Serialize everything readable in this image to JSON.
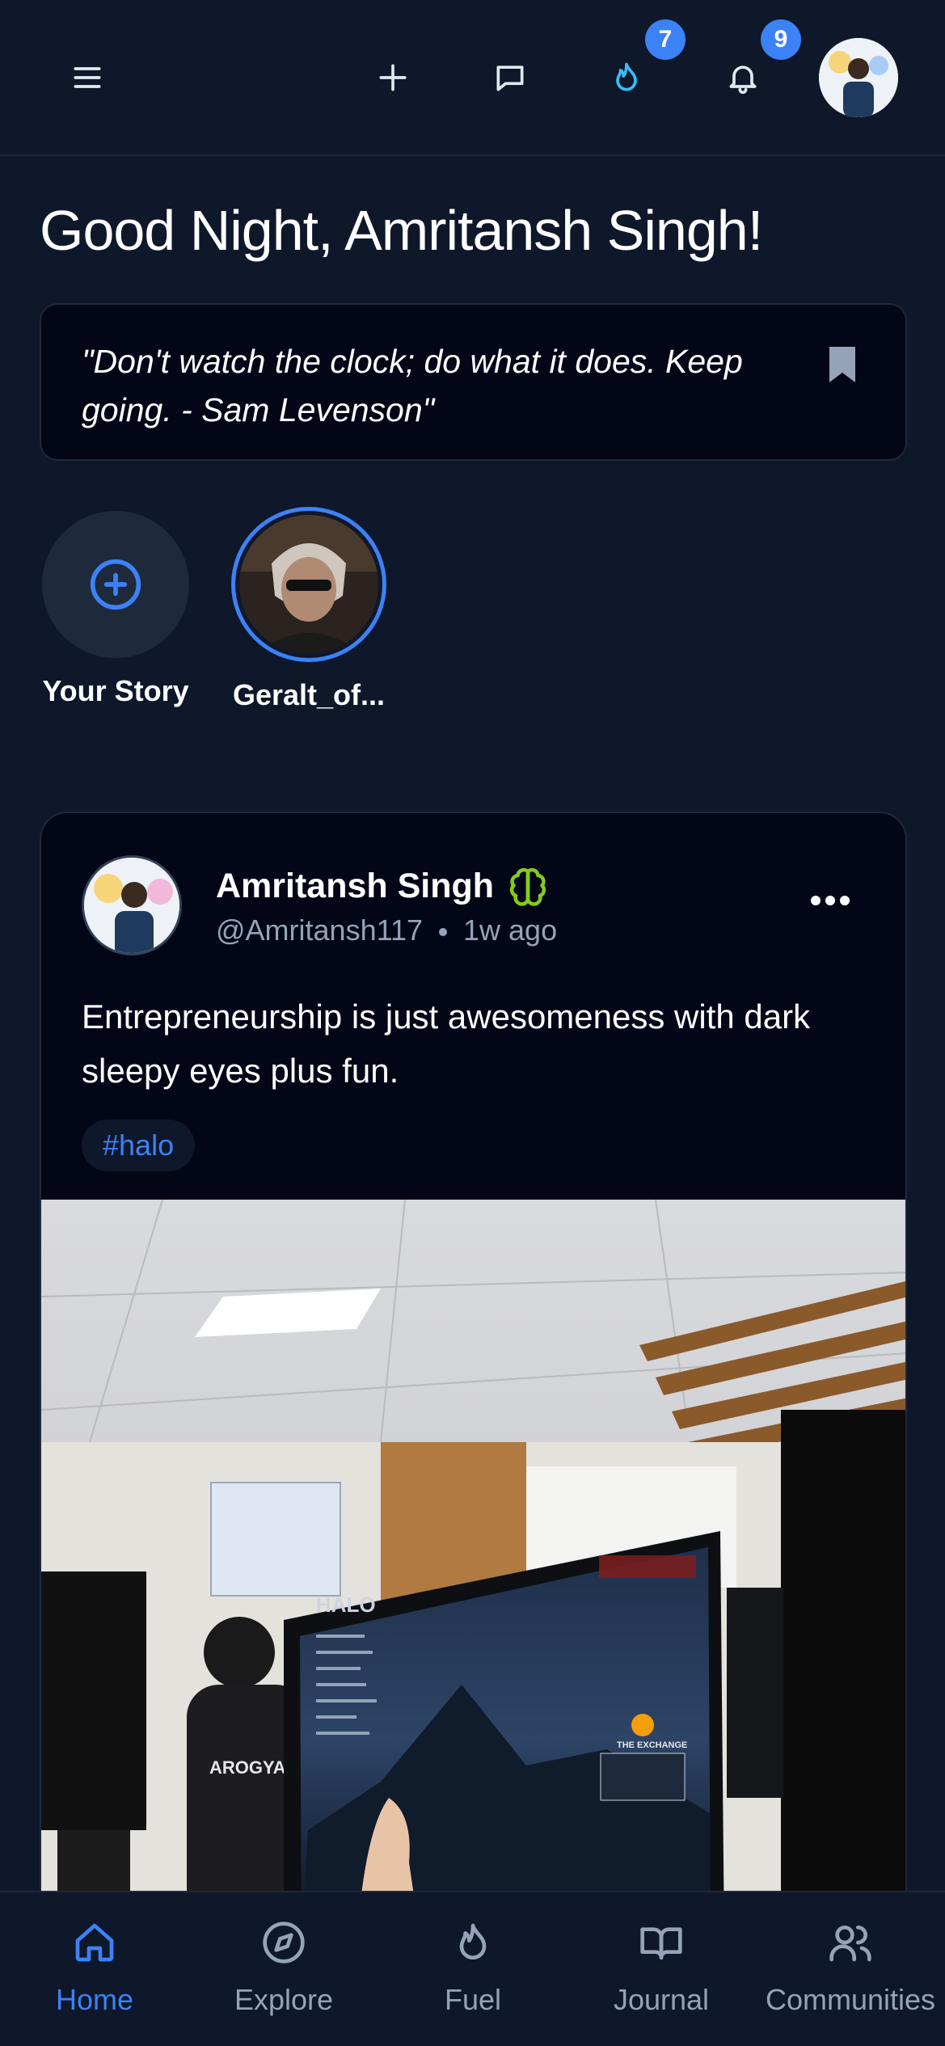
{
  "header": {
    "notifications_badges": {
      "fuel": "7",
      "bell": "9"
    }
  },
  "greeting": "Good Night, Amritansh Singh!",
  "quote": {
    "text": "\"Don't watch the clock; do what it does. Keep going. - Sam Levenson\""
  },
  "stories": [
    {
      "label": "Your Story"
    },
    {
      "label": "Geralt_of..."
    }
  ],
  "post": {
    "author_name": "Amritansh Singh",
    "handle": "@Amritansh117",
    "time": "1w ago",
    "body": "Entrepreneurship is just awesomeness with dark sleepy eyes plus fun.",
    "hashtag": "#halo",
    "image_text": {
      "brand": "HALO",
      "exchange": "THE EXCHANGE",
      "shirt": "AROGYA SHIELD"
    }
  },
  "bottom_nav": [
    {
      "label": "Home",
      "icon": "home-icon",
      "active": true
    },
    {
      "label": "Explore",
      "icon": "compass-icon",
      "active": false
    },
    {
      "label": "Fuel",
      "icon": "flame-icon",
      "active": false
    },
    {
      "label": "Journal",
      "icon": "book-icon",
      "active": false
    },
    {
      "label": "Communities",
      "icon": "users-icon",
      "active": false
    }
  ],
  "colors": {
    "background": "#0f172a",
    "card": "#020617",
    "accent": "#3b82f6",
    "muted": "#94a3b8",
    "fuel_accent": "#38bdf8",
    "brain_green": "#84cc16"
  }
}
